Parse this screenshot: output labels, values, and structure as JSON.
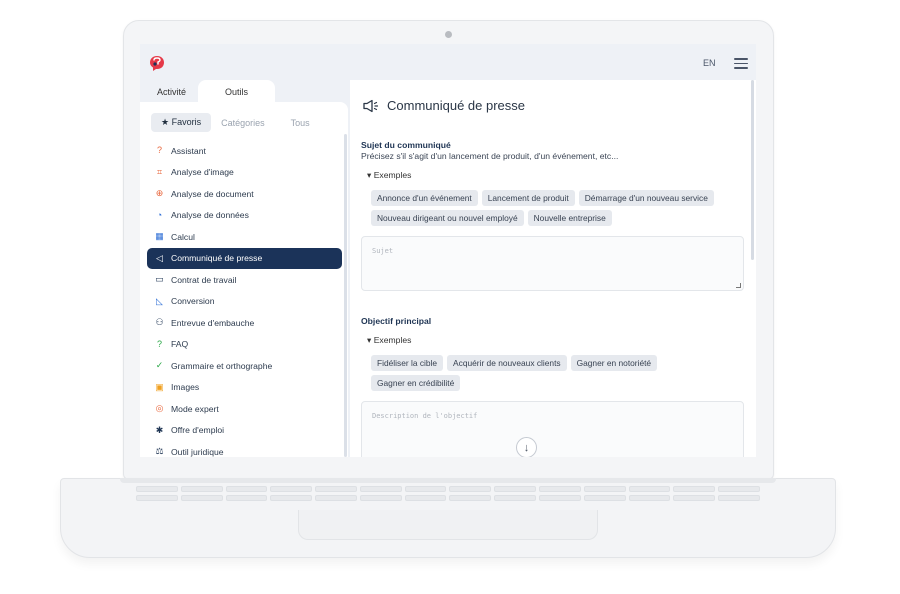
{
  "header": {
    "lang": "EN"
  },
  "tabs": [
    {
      "label": "Activité"
    },
    {
      "label": "Outils"
    }
  ],
  "subtabs": [
    {
      "label": "★ Favoris"
    },
    {
      "label": "Catégories"
    },
    {
      "label": "Tous"
    }
  ],
  "tools": [
    {
      "label": "Assistant",
      "icon": "assistant-icon",
      "color": "#e8663c",
      "glyph": "?"
    },
    {
      "label": "Analyse d'image",
      "icon": "image-analysis-icon",
      "color": "#e8663c",
      "glyph": "⌗"
    },
    {
      "label": "Analyse de document",
      "icon": "document-analysis-icon",
      "color": "#e8663c",
      "glyph": "⊕"
    },
    {
      "label": "Analyse de données",
      "icon": "data-analysis-icon",
      "color": "#2f6fd6",
      "glyph": "◔"
    },
    {
      "label": "Calcul",
      "icon": "calculator-icon",
      "color": "#2f6fd6",
      "glyph": "▦"
    },
    {
      "label": "Communiqué de presse",
      "icon": "megaphone-icon",
      "color": "#ffffff",
      "glyph": "◁"
    },
    {
      "label": "Contrat de travail",
      "icon": "briefcase-icon",
      "color": "#1f3554",
      "glyph": "▭"
    },
    {
      "label": "Conversion",
      "icon": "ruler-icon",
      "color": "#2f6fd6",
      "glyph": "◺"
    },
    {
      "label": "Entrevue d'embauche",
      "icon": "interview-icon",
      "color": "#1f3554",
      "glyph": "⚇"
    },
    {
      "label": "FAQ",
      "icon": "faq-icon",
      "color": "#28a745",
      "glyph": "?"
    },
    {
      "label": "Grammaire et orthographe",
      "icon": "check-icon",
      "color": "#28a745",
      "glyph": "✓"
    },
    {
      "label": "Images",
      "icon": "images-icon",
      "color": "#f0a020",
      "glyph": "▣"
    },
    {
      "label": "Mode expert",
      "icon": "expert-icon",
      "color": "#e8663c",
      "glyph": "◎"
    },
    {
      "label": "Offre d'emploi",
      "icon": "job-offer-icon",
      "color": "#1f3554",
      "glyph": "✱"
    },
    {
      "label": "Outil juridique",
      "icon": "scales-icon",
      "color": "#1f3554",
      "glyph": "⚖"
    }
  ],
  "main": {
    "title": "Communiqué de presse",
    "section1": {
      "title": "Sujet du communiqué",
      "desc": "Précisez s'il s'agit d'un lancement de produit, d'un événement, etc...",
      "examples_label": "Exemples",
      "chips": [
        "Annonce d'un événement",
        "Lancement de produit",
        "Démarrage d'un nouveau service",
        "Nouveau dirigeant ou nouvel employé",
        "Nouvelle entreprise"
      ],
      "placeholder": "Sujet"
    },
    "section2": {
      "title": "Objectif principal",
      "examples_label": "Exemples",
      "chips": [
        "Fidéliser la cible",
        "Acquérir de nouveaux clients",
        "Gagner en notoriété",
        "Gagner en crédibilité"
      ],
      "placeholder": "Description de l'objectif"
    }
  }
}
